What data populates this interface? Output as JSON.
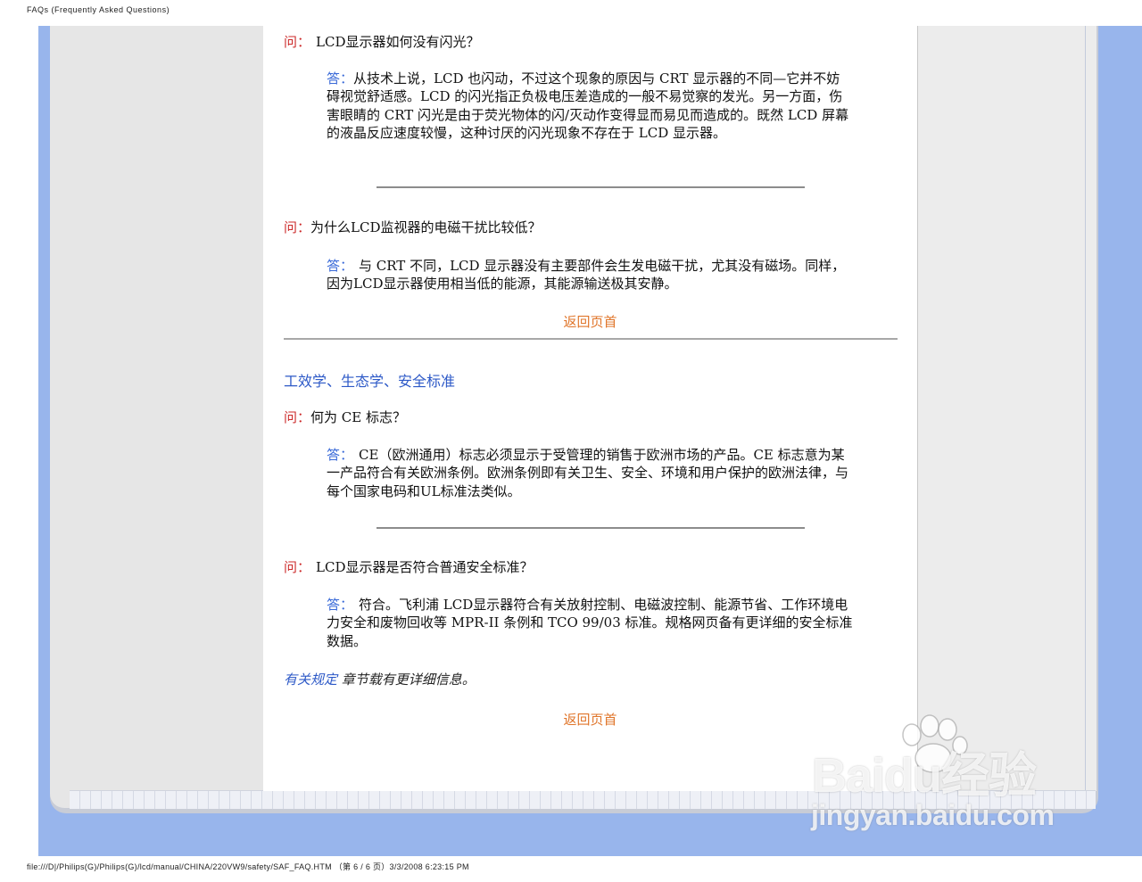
{
  "print": {
    "header": "FAQs (Frequently Asked Questions)",
    "footer": "file:///D|/Philips(G)/Philips(G)/lcd/manual/CHINA/220VW9/safety/SAF_FAQ.HTM （第 6 / 6 页）3/3/2008 6:23:15 PM"
  },
  "labels": {
    "q": "问：",
    "a": "答："
  },
  "faq": [
    {
      "question": "LCD显示器如何没有闪光？",
      "answer": "从技术上说，LCD 也闪动，不过这个现象的原因与 CRT 显示器的不同—它并不妨碍视觉舒适感。LCD 的闪光指正负极电压差造成的一般不易觉察的发光。另一方面，伤害眼睛的 CRT 闪光是由于荧光物体的闪/灭动作变得显而易见而造成的。既然 LCD 屏幕的液晶反应速度较慢，这种讨厌的闪光现象不存在于 LCD 显示器。"
    },
    {
      "question": "为什么LCD监视器的电磁干扰比较低？",
      "answer": "与 CRT 不同，LCD 显示器没有主要部件会生发电磁干扰，尤其没有磁场。同样，因为LCD显示器使用相当低的能源，其能源输送极其安静。"
    },
    {
      "question": "何为 CE 标志？",
      "answer": "CE（欧洲通用）标志必须显示于受管理的销售于欧洲市场的产品。CE 标志意为某一产品符合有关欧洲条例。欧洲条例即有关卫生、安全、环境和用户保护的欧洲法律，与每个国家电码和UL标准法类似。"
    },
    {
      "question": "LCD显示器是否符合普通安全标准？",
      "answer": "符合。飞利浦 LCD显示器符合有关放射控制、电磁波控制、能源节省、工作环境电力安全和废物回收等 MPR-II 条例和 TCO 99/03 标准。规格网页备有更详细的安全标准数据。"
    }
  ],
  "section_title": "工效学、生态学、安全标准",
  "back_to_top": "返回页首",
  "note": {
    "link": "有关规定",
    "rest": " 章节载有更详细信息。"
  },
  "watermark": {
    "main": "Baidu经验",
    "sub": "jingyan.baidu.com"
  }
}
